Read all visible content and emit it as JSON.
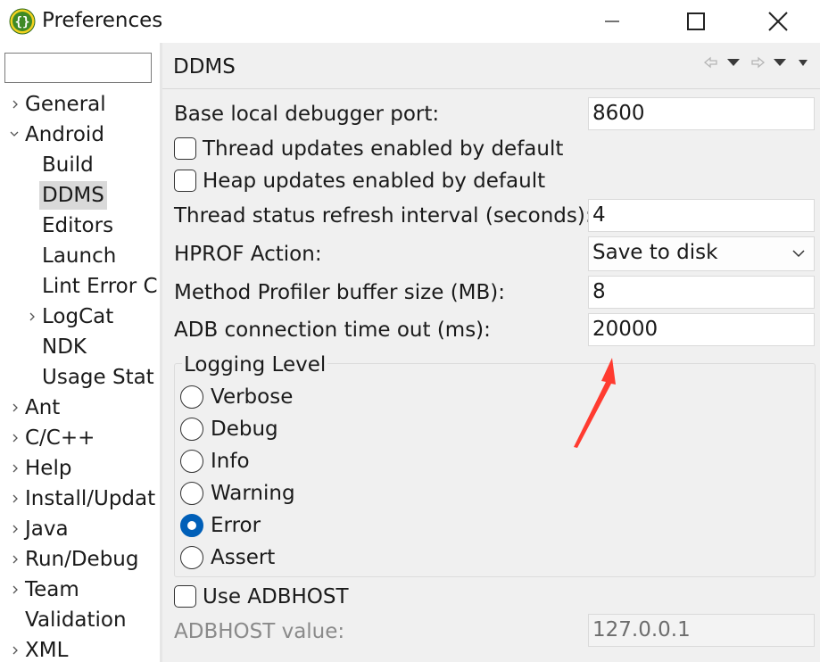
{
  "window": {
    "title": "Preferences",
    "icons": {
      "app": "eclipse-braces-icon",
      "minimize": "minimize-icon",
      "maximize": "maximize-icon",
      "close": "close-icon"
    }
  },
  "sidebar": {
    "filter": {
      "value": "",
      "placeholder": ""
    },
    "items": [
      {
        "label": "General",
        "expandable": true,
        "expanded": false,
        "level": 0
      },
      {
        "label": "Android",
        "expandable": true,
        "expanded": true,
        "level": 0
      },
      {
        "label": "Build",
        "expandable": false,
        "level": 1
      },
      {
        "label": "DDMS",
        "expandable": false,
        "level": 1,
        "selected": true
      },
      {
        "label": "Editors",
        "expandable": false,
        "level": 1
      },
      {
        "label": "Launch",
        "expandable": false,
        "level": 1
      },
      {
        "label": "Lint Error C",
        "expandable": false,
        "level": 1
      },
      {
        "label": "LogCat",
        "expandable": true,
        "expanded": false,
        "level": 1
      },
      {
        "label": "NDK",
        "expandable": false,
        "level": 1
      },
      {
        "label": "Usage Stat",
        "expandable": false,
        "level": 1
      },
      {
        "label": "Ant",
        "expandable": true,
        "expanded": false,
        "level": 0
      },
      {
        "label": "C/C++",
        "expandable": true,
        "expanded": false,
        "level": 0
      },
      {
        "label": "Help",
        "expandable": true,
        "expanded": false,
        "level": 0
      },
      {
        "label": "Install/Updat",
        "expandable": true,
        "expanded": false,
        "level": 0
      },
      {
        "label": "Java",
        "expandable": true,
        "expanded": false,
        "level": 0
      },
      {
        "label": "Run/Debug",
        "expandable": true,
        "expanded": false,
        "level": 0
      },
      {
        "label": "Team",
        "expandable": true,
        "expanded": false,
        "level": 0
      },
      {
        "label": "Validation",
        "expandable": false,
        "level": 0
      },
      {
        "label": "XML",
        "expandable": true,
        "expanded": false,
        "level": 0
      }
    ]
  },
  "page": {
    "title": "DDMS",
    "nav_icons": [
      "back-arrow-icon",
      "back-menu-icon",
      "forward-arrow-icon",
      "forward-menu-icon",
      "view-menu-icon"
    ],
    "debugger_port": {
      "label": "Base local debugger port:",
      "value": "8600"
    },
    "thread_updates": {
      "label": "Thread updates enabled by default",
      "checked": false
    },
    "heap_updates": {
      "label": "Heap updates enabled by default",
      "checked": false
    },
    "thread_refresh": {
      "label": "Thread status refresh interval (seconds):",
      "value": "4"
    },
    "hprof_action": {
      "label": "HPROF Action:",
      "value": "Save to disk"
    },
    "profiler_buffer": {
      "label": "Method Profiler buffer size (MB):",
      "value": "8"
    },
    "adb_timeout": {
      "label": "ADB connection time out (ms):",
      "value": "20000"
    },
    "logging": {
      "legend": "Logging Level",
      "options": [
        "Verbose",
        "Debug",
        "Info",
        "Warning",
        "Error",
        "Assert"
      ],
      "selected": "Error"
    },
    "use_adbhost": {
      "label": "Use ADBHOST",
      "checked": false
    },
    "adbhost_value": {
      "label": "ADBHOST value:",
      "value": "127.0.0.1",
      "enabled": false
    }
  },
  "colors": {
    "accent": "#005fb8",
    "annotation": "#ff3b30",
    "pane_bg": "#f0f0f0",
    "selection_bg": "#d9d9d9"
  },
  "annotation": {
    "icon": "red-arrow-icon"
  }
}
